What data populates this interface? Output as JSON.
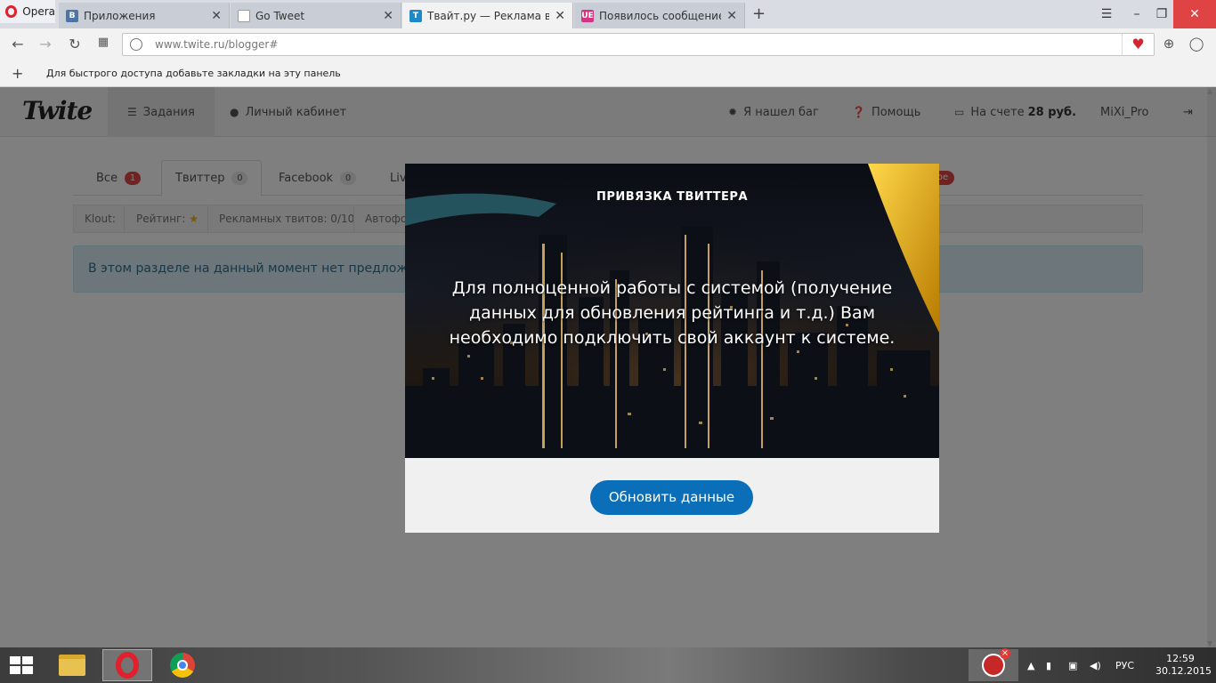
{
  "browser": {
    "menu_label": "Opera",
    "tabs": [
      {
        "label": "Приложения",
        "favicon": "vk-icon",
        "favicon_color": "#4c75a3",
        "favicon_text": "В"
      },
      {
        "label": "Go Tweet",
        "favicon": "document-icon",
        "favicon_color": "#999999",
        "favicon_text": ""
      },
      {
        "label": "Твайт.ру — Реклама в Тви",
        "favicon": "twite-icon",
        "favicon_color": "#1e88c9",
        "favicon_text": "T"
      },
      {
        "label": "Появилось сообщение о",
        "favicon": "ue-icon",
        "favicon_color": "#d63384",
        "favicon_text": "UE"
      }
    ],
    "new_tab_symbol": "+",
    "url": "www.twite.ru/blogger#",
    "bookmarks_hint": "Для быстрого доступа добавьте закладки на эту панель"
  },
  "site": {
    "logo": "Twite",
    "nav": {
      "tasks": "Задания",
      "cabinet": "Личный кабинет",
      "bug": "Я нашел баг",
      "help": "Помощь",
      "balance_prefix": "На счете",
      "balance_value": "28 руб.",
      "user": "MiXi_Pro"
    },
    "tabs": [
      {
        "label": "Все",
        "count": "1"
      },
      {
        "label": "Твиттер",
        "count": "0"
      },
      {
        "label": "Facebook",
        "count": "0"
      },
      {
        "label": "Liv",
        "count": ""
      }
    ],
    "new_badge": "вое",
    "stats": {
      "klout": "Klout:",
      "rating": "Рейтинг:",
      "ad_tweets": "Рекламных твитов: 0/10",
      "auto": "Автофо"
    },
    "info_message": "В этом разделе на данный момент нет предложе"
  },
  "modal": {
    "title": "ПРИВЯЗКА ТВИТТЕРА",
    "text": "Для полноценной работы с системой (получение данных для обновления рейтинга и т.д.) Вам необходимо подключить свой аккаунт к системе.",
    "button": "Обновить данные"
  },
  "taskbar": {
    "language": "РУС",
    "time": "12:59",
    "date": "30.12.2015"
  },
  "colors": {
    "accent_button": "#0a6eb8",
    "badge_red": "#e14646",
    "info_bg": "#d9edf7",
    "opera_red": "#e0202c"
  }
}
